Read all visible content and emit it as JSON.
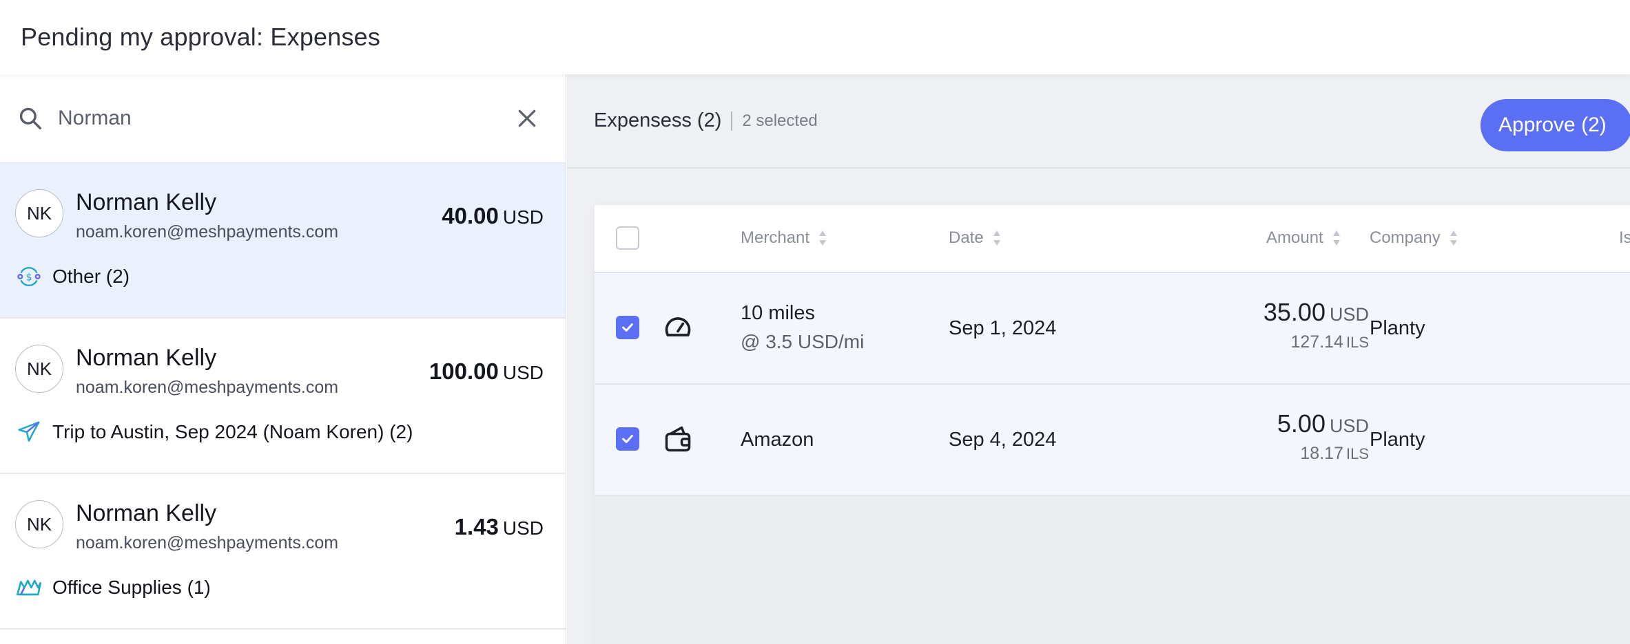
{
  "header": {
    "title": "Pending my approval: Expenses"
  },
  "search": {
    "value": "Norman",
    "placeholder": "Search"
  },
  "requests": [
    {
      "initials": "NK",
      "name": "Norman Kelly",
      "email": "noam.koren@meshpayments.com",
      "amount": "40.00",
      "currency": "USD",
      "category": "Other (2)",
      "category_icon": "money-flow-icon",
      "selected": true
    },
    {
      "initials": "NK",
      "name": "Norman Kelly",
      "email": "noam.koren@meshpayments.com",
      "amount": "100.00",
      "currency": "USD",
      "category": "Trip to Austin, Sep 2024 (Noam Koren) (2)",
      "category_icon": "airplane-icon",
      "selected": false
    },
    {
      "initials": "NK",
      "name": "Norman Kelly",
      "email": "noam.koren@meshpayments.com",
      "amount": "1.43",
      "currency": "USD",
      "category": "Office Supplies (1)",
      "category_icon": "office-supplies-icon",
      "selected": false
    }
  ],
  "toolbar": {
    "title": "Expensess (2)",
    "selected_text": "2 selected",
    "approve_label": "Approve (2)"
  },
  "table": {
    "columns": {
      "merchant": "Merchant",
      "date": "Date",
      "amount": "Amount",
      "company": "Company",
      "extra": "Is"
    },
    "rows": [
      {
        "icon": "speedometer-icon",
        "merchant": "10 miles",
        "merchant_sub": "@ 3.5 USD/mi",
        "date": "Sep 1, 2024",
        "amount": "35.00",
        "currency": "USD",
        "amount_converted": "127.14",
        "converted_currency": "ILS",
        "company": "Planty",
        "checked": true
      },
      {
        "icon": "wallet-icon",
        "merchant": "Amazon",
        "merchant_sub": "",
        "date": "Sep 4, 2024",
        "amount": "5.00",
        "currency": "USD",
        "amount_converted": "18.17",
        "converted_currency": "ILS",
        "company": "Planty",
        "checked": true
      }
    ]
  },
  "colors": {
    "accent": "#5b6ff5",
    "selected_bg": "#ebf0fd",
    "row_bg": "#f3f6fd",
    "panel_bg": "#eef0f3",
    "category_icon_teal": "#23a8c6"
  }
}
